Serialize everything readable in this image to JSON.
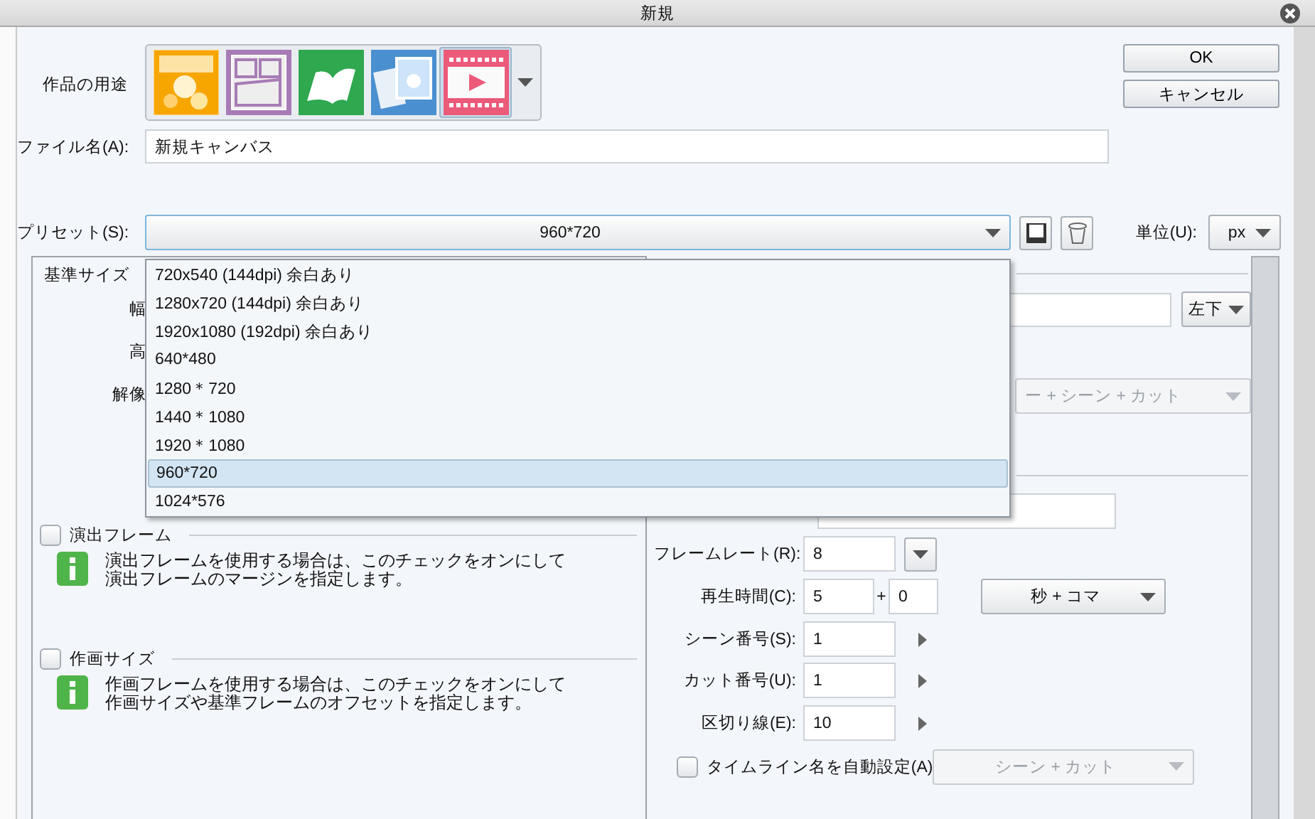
{
  "window": {
    "title": "新規"
  },
  "buttons": [
    {
      "label": "OK"
    },
    {
      "label": "キャンセル"
    }
  ],
  "usage": {
    "label": "作品の用途",
    "options": [
      {
        "kind": "illustration",
        "selected": false
      },
      {
        "kind": "comic",
        "selected": false
      },
      {
        "kind": "book",
        "selected": false
      },
      {
        "kind": "photo",
        "selected": false
      },
      {
        "kind": "animation",
        "selected": true
      }
    ]
  },
  "file_name": {
    "label": "ファイル名(A):",
    "value": "新規キャンバス"
  },
  "preset": {
    "label": "プリセット(S):",
    "value": "960*720",
    "expanded": true,
    "options": [
      {
        "label": "720x540 (144dpi) 余白あり",
        "selected": false
      },
      {
        "label": "1280x720 (144dpi) 余白あり",
        "selected": false
      },
      {
        "label": "1920x1080 (192dpi) 余白あり",
        "selected": false
      },
      {
        "label": "640*480",
        "selected": false
      },
      {
        "label": "1280＊720",
        "selected": false
      },
      {
        "label": "1440＊1080",
        "selected": false
      },
      {
        "label": "1920＊1080",
        "selected": false
      },
      {
        "label": "960*720",
        "selected": true
      },
      {
        "label": "1024*576",
        "selected": false
      }
    ]
  },
  "unit": {
    "label": "単位(U):",
    "value": "px"
  },
  "base_size": {
    "title": "基準サイズ",
    "labels": [
      "幅",
      "高",
      "解像"
    ]
  },
  "anchor": {
    "value": "左下"
  },
  "naming": {
    "value": "ー + シーン + カット",
    "disabled": true
  },
  "frame_sections": [
    {
      "label": "演出フレーム",
      "checked": false,
      "info": [
        "演出フレームを使用する場合は、このチェックをオンにして",
        "演出フレームのマージンを指定します。"
      ]
    },
    {
      "label": "作画サイズ",
      "checked": false,
      "info": [
        "作画フレームを使用する場合は、このチェックをオンにして",
        "作画サイズや基準フレームのオフセットを指定します。"
      ]
    }
  ],
  "timeline": {
    "fields": [
      {
        "kind": "rate",
        "label": "フレームレート(R):",
        "value": "8"
      },
      {
        "kind": "duration",
        "label": "再生時間(C):",
        "value": "5",
        "separator": "+",
        "value_2": "0",
        "unit": "秒 + コマ"
      },
      {
        "kind": "number",
        "label": "シーン番号(S):",
        "value": "1"
      },
      {
        "kind": "number",
        "label": "カット番号(U):",
        "value": "1"
      },
      {
        "kind": "number",
        "label": "区切り線(E):",
        "value": "10"
      }
    ],
    "auto_name": {
      "label": "タイムライン名を自動設定(A)",
      "checked": false,
      "value": "シーン + カット",
      "disabled": true
    }
  }
}
